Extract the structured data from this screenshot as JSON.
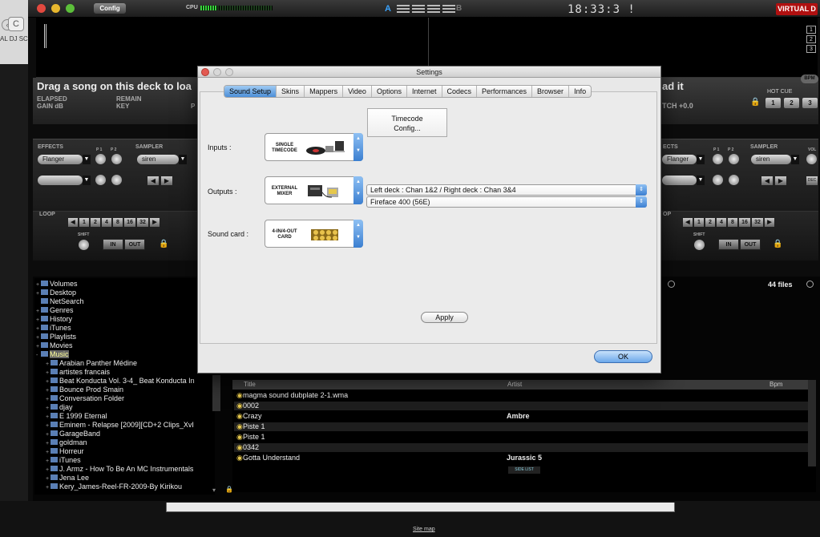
{
  "browser": {
    "tab_title": "AL DJ SC",
    "back": "‹",
    "reload": "C",
    "site_map": "Site map"
  },
  "top": {
    "config": "Config",
    "cpu": "CPU",
    "mix_a": "A",
    "mix_b": "B",
    "clock": "18:33:3 !",
    "logo": "VIRTUAL D",
    "deck_buttons": [
      "1",
      "2",
      "3"
    ]
  },
  "deck_left": {
    "title": "Drag a song on this deck to loa",
    "elapsed": "ELAPSED",
    "remain": "REMAIN",
    "gain": "GAIN dB",
    "key": "KEY",
    "p": "P"
  },
  "deck_right": {
    "title": "ad it",
    "pitch": "TCH +0.0",
    "bpm": "BPM",
    "hot_cue": "HOT CUE",
    "hot_cue_btns": [
      "1",
      "2",
      "3"
    ]
  },
  "fx_left": {
    "effects": "EFFECTS",
    "sampler": "SAMPLER",
    "effect_name": "Flanger",
    "sampler_name": "siren",
    "p1": "P 1",
    "p2": "P 2"
  },
  "fx_right": {
    "effects": "ECTS",
    "sampler": "SAMPLER",
    "vol": "VOL",
    "effect_name": "Flanger",
    "sampler_name": "siren",
    "p1": "P 1",
    "p2": "P 2",
    "dec": "DEC"
  },
  "loop": {
    "label": "LOOP",
    "label_r": "OP",
    "sizes": [
      "1",
      "2",
      "4",
      "8",
      "16",
      "32"
    ],
    "shift": "SHIFT",
    "in": "IN",
    "out": "OUT"
  },
  "tree": [
    {
      "label": "Volumes",
      "pm": "+",
      "level": 0
    },
    {
      "label": "Desktop",
      "pm": "+",
      "level": 0
    },
    {
      "label": "NetSearch",
      "pm": "",
      "level": 0
    },
    {
      "label": "Genres",
      "pm": "+",
      "level": 0
    },
    {
      "label": "History",
      "pm": "+",
      "level": 0
    },
    {
      "label": "iTunes",
      "pm": "+",
      "level": 0
    },
    {
      "label": "Playlists",
      "pm": "+",
      "level": 0
    },
    {
      "label": "Movies",
      "pm": "+",
      "level": 0
    },
    {
      "label": "Music",
      "pm": "-",
      "level": 0,
      "selected": true
    },
    {
      "label": "Arabian Panther Médine",
      "pm": "+",
      "level": 1
    },
    {
      "label": "artistes francais",
      "pm": "+",
      "level": 1
    },
    {
      "label": "Beat Konducta Vol. 3-4_ Beat Konducta In",
      "pm": "+",
      "level": 1
    },
    {
      "label": "Bounce Prod Smain",
      "pm": "+",
      "level": 1
    },
    {
      "label": "Conversation Folder",
      "pm": "+",
      "level": 1
    },
    {
      "label": "djay",
      "pm": "+",
      "level": 1
    },
    {
      "label": "E 1999 Eternal",
      "pm": "+",
      "level": 1
    },
    {
      "label": "Eminem - Relapse [2009][CD+2 Clips_XvI",
      "pm": "+",
      "level": 1
    },
    {
      "label": "GarageBand",
      "pm": "+",
      "level": 1
    },
    {
      "label": "goldman",
      "pm": "+",
      "level": 1
    },
    {
      "label": "Horreur",
      "pm": "+",
      "level": 1
    },
    {
      "label": "iTunes",
      "pm": "+",
      "level": 1
    },
    {
      "label": "J. Armz - How To Be An MC Instrumentals",
      "pm": "+",
      "level": 1
    },
    {
      "label": "Jena Lee",
      "pm": "+",
      "level": 1
    },
    {
      "label": "Kery_James-Reel-FR-2009-By Kirikou",
      "pm": "+",
      "level": 1
    }
  ],
  "files": {
    "count": "44 files",
    "columns": {
      "title": "Title",
      "artist": "Artist",
      "bpm": "Bpm"
    },
    "rows": [
      {
        "title": "magma sound dubplate 2-1.wma",
        "artist": ""
      },
      {
        "title": "0002",
        "artist": ""
      },
      {
        "title": "Crazy",
        "artist": "Ambre"
      },
      {
        "title": "Piste 1",
        "artist": ""
      },
      {
        "title": "Piste 1",
        "artist": ""
      },
      {
        "title": "0342",
        "artist": ""
      },
      {
        "title": "Gotta Understand",
        "artist": "Jurassic 5"
      }
    ],
    "side_list": "SIDE LIST"
  },
  "settings": {
    "title": "Settings",
    "tabs": [
      "Sound Setup",
      "Skins",
      "Mappers",
      "Video",
      "Options",
      "Internet",
      "Codecs",
      "Performances",
      "Browser",
      "Info"
    ],
    "active_tab": 0,
    "inputs_label": "Inputs :",
    "inputs_selector": "SINGLE TIMECODE",
    "timecode_line1": "Timecode",
    "timecode_line2": "Config...",
    "outputs_label": "Outputs :",
    "outputs_selector": "EXTERNAL MIXER",
    "outputs_value": "Left deck : Chan 1&2 / Right deck : Chan 3&4",
    "soundcard_label": "Sound card :",
    "soundcard_selector": "4-IN/4-OUT CARD",
    "soundcard_value": "Fireface 400 (56E)",
    "apply": "Apply",
    "ok": "OK"
  },
  "colors": {
    "accent_blue": "#4c8fd8",
    "logo_red": "#b01010",
    "cpu_green": "#36d43a",
    "lock_orange": "#e28a16"
  }
}
